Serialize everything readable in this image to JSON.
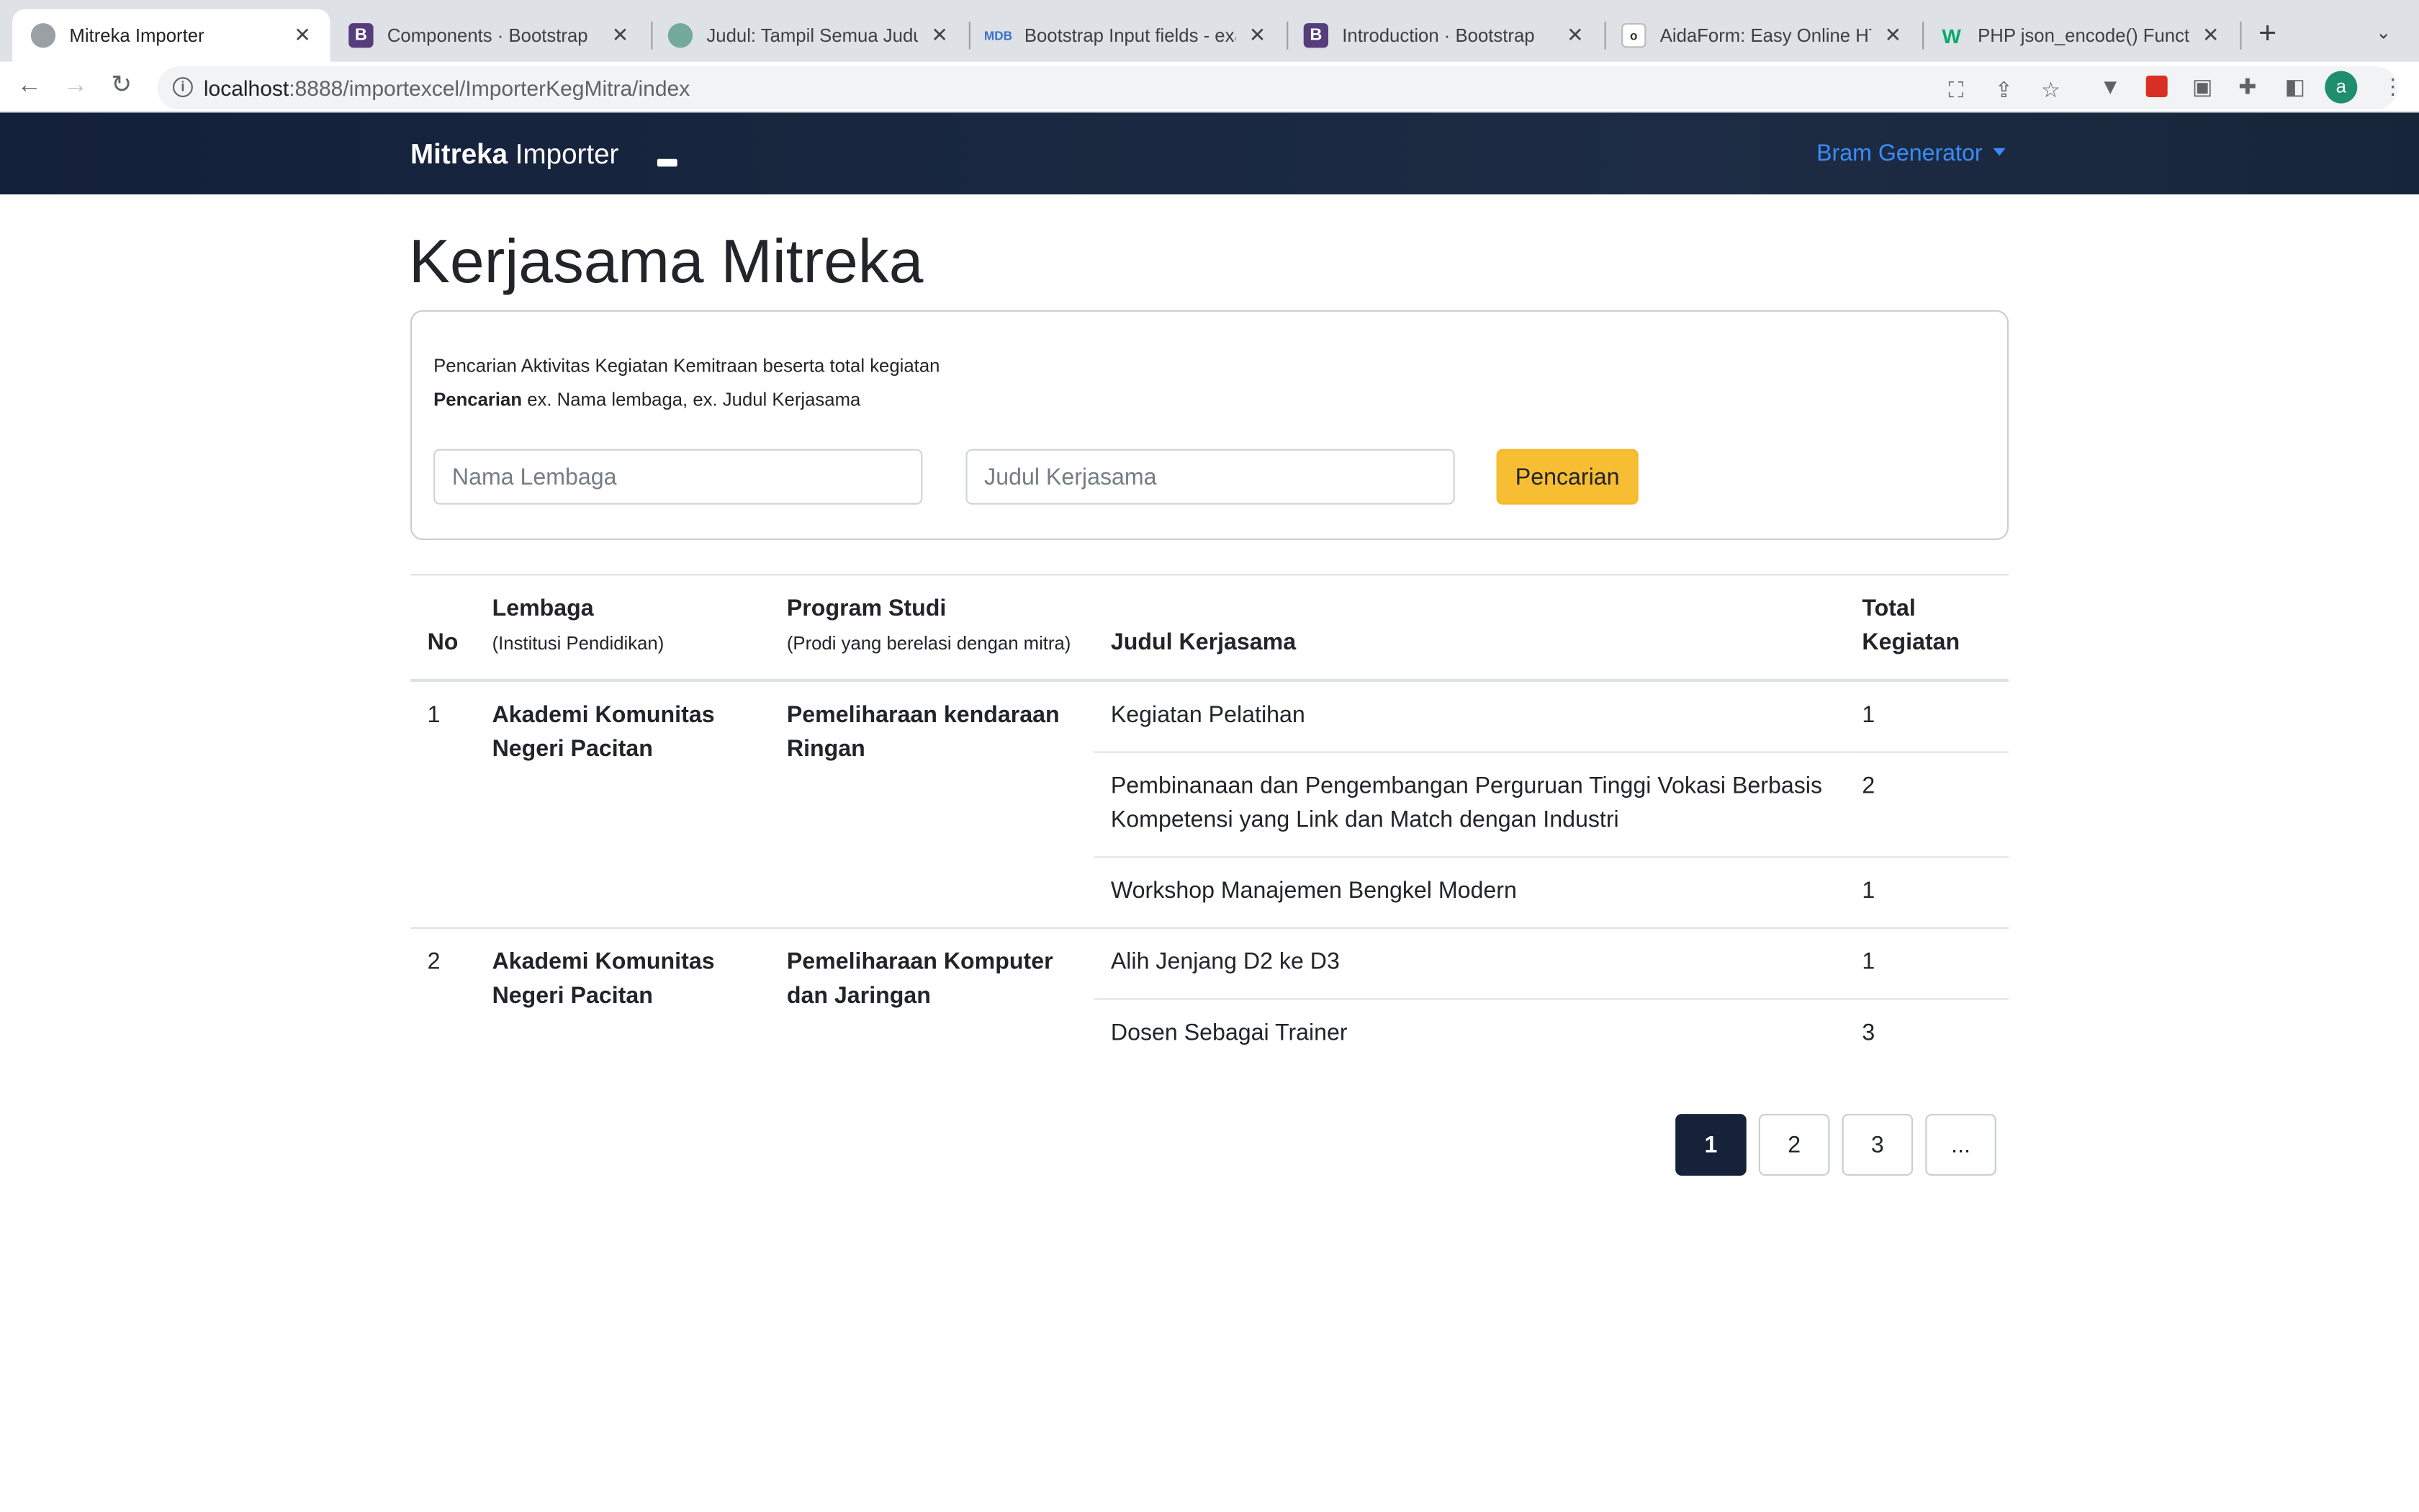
{
  "browser": {
    "tabs": [
      {
        "title": "Mitreka Importer",
        "icon": "globe-icon",
        "active": true
      },
      {
        "title": "Components · Bootstrap",
        "icon": "bootstrap-icon"
      },
      {
        "title": "Judul: Tampil Semua Judul",
        "icon": "chatgpt-icon"
      },
      {
        "title": "Bootstrap Input fields - exa",
        "icon": "mdb-icon"
      },
      {
        "title": "Introduction · Bootstrap",
        "icon": "bootstrap-icon"
      },
      {
        "title": "AidaForm: Easy Online HTM",
        "icon": "aidaform-icon"
      },
      {
        "title": "PHP json_encode() Functio",
        "icon": "w3schools-icon"
      }
    ],
    "url_host": "localhost",
    "url_rest": ":8888/importexcel/ImporterKegMitra/index",
    "avatar_letter": "a"
  },
  "navbar": {
    "brand_strong": "Mitreka",
    "brand_rest": " Importer",
    "user": "Bram Generator"
  },
  "main": {
    "title": "Kerjasama Mitreka",
    "search": {
      "desc_line1": "Pencarian Aktivitas Kegiatan Kemitraan beserta total kegiatan",
      "desc_label": "Pencarian",
      "desc_rest": " ex. Nama lembaga, ex. Judul Kerjasama",
      "placeholder_lembaga": "Nama Lembaga",
      "placeholder_judul": "Judul Kerjasama",
      "button": "Pencarian"
    },
    "table": {
      "headers": {
        "no": "No",
        "lembaga": "Lembaga",
        "lembaga_sub": "(Institusi Pendidikan)",
        "prodi": "Program Studi",
        "prodi_sub": "(Prodi yang berelasi dengan mitra)",
        "judul": "Judul Kerjasama",
        "total_line1": "Total",
        "total_line2": "Kegiatan"
      },
      "groups": [
        {
          "no": "1",
          "lembaga": "Akademi Komunitas Negeri Pacitan",
          "prodi": "Pemeliharaan kendaraan Ringan",
          "items": [
            {
              "judul": "Kegiatan Pelatihan",
              "total": "1"
            },
            {
              "judul": "Pembinanaan dan Pengembangan Perguruan Tinggi Vokasi Berbasis Kompetensi yang Link dan Match dengan Industri",
              "total": "2"
            },
            {
              "judul": "Workshop Manajemen Bengkel Modern",
              "total": "1"
            }
          ]
        },
        {
          "no": "2",
          "lembaga": "Akademi Komunitas Negeri Pacitan",
          "prodi": "Pemeliharaan Komputer dan Jaringan",
          "items": [
            {
              "judul": "Alih Jenjang D2 ke D3",
              "total": "1"
            },
            {
              "judul": "Dosen Sebagai Trainer",
              "total": "3"
            }
          ]
        }
      ]
    },
    "pagination": [
      "1",
      "2",
      "3",
      "..."
    ],
    "active_page": "1"
  },
  "colors": {
    "navbar": "#1a2840",
    "accent_link": "#3a8cf7",
    "search_button": "#f8be33",
    "active_page": "#15223a"
  }
}
